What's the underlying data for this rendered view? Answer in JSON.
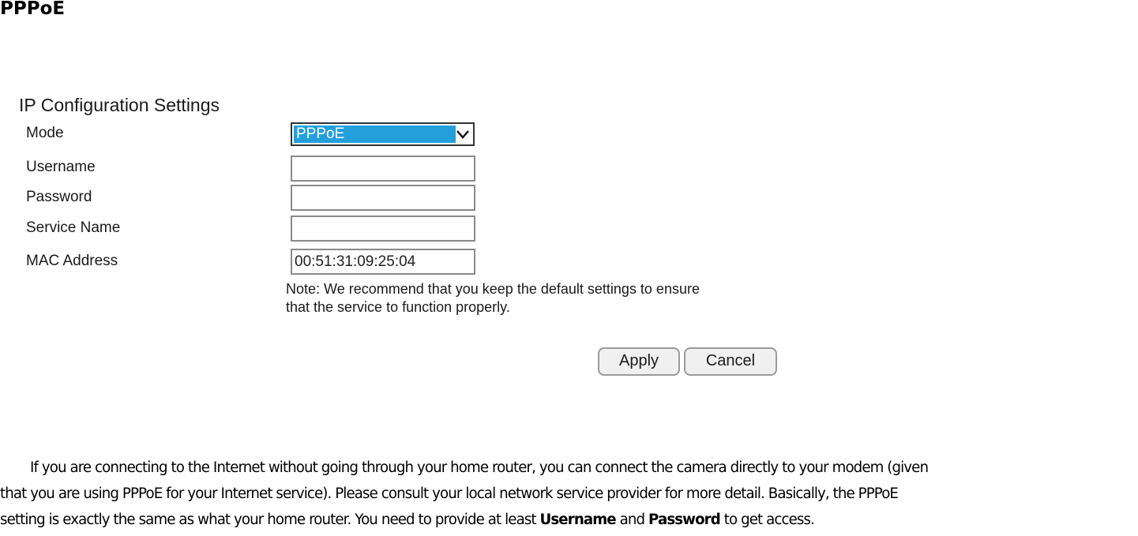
{
  "document": {
    "heading": "PPPoE"
  },
  "form": {
    "title": "IP Configuration Settings",
    "fields": [
      {
        "label": "Mode",
        "type": "select",
        "value": "PPPoE"
      },
      {
        "label": "Username",
        "type": "text",
        "value": ""
      },
      {
        "label": "Password",
        "type": "password",
        "value": ""
      },
      {
        "label": "Service Name",
        "type": "text",
        "value": ""
      },
      {
        "label": "MAC Address",
        "type": "text",
        "value": "00:51:31:09:25:04"
      }
    ],
    "note_line1": "Note: We recommend that you keep the default settings to ensure",
    "note_line2": "that the service to function properly.",
    "apply_label": "Apply",
    "cancel_label": "Cancel",
    "select_highlight_color": "#239fdc",
    "select_arrow_icon": "chevron-down-icon"
  },
  "paragraph": {
    "line1": "If you are connecting to the Internet without going through your home router, you can connect the camera directly to your modem (given",
    "line2": "that you are using PPPoE for your Internet service). Please consult your local network service provider for more detail. Basically, the PPPoE",
    "line3_pre": "setting is exactly the same as what your home router. You need to provide at least ",
    "bold1": "Username",
    "mid": " and ",
    "bold2": "Password",
    "line3_post": " to get access."
  }
}
